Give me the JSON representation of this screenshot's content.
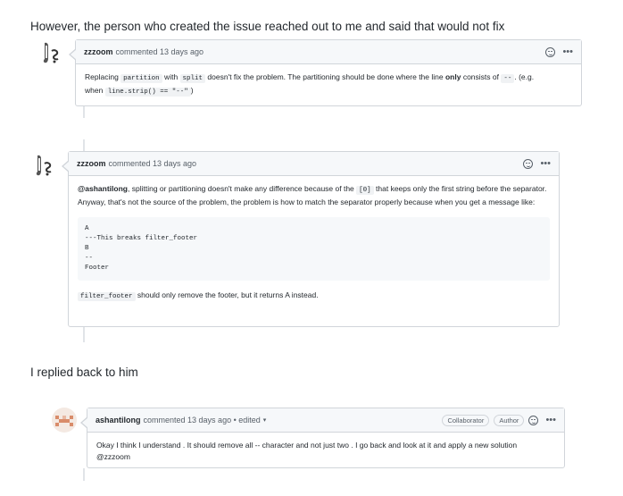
{
  "prose": {
    "line1": "However, the person who created the issue reached out to me and said that would not fix",
    "line2": "I replied back to him"
  },
  "comments": [
    {
      "author": "zzzoom",
      "meta": "commented 13 days ago",
      "body": {
        "t1": "Replacing ",
        "c1": "partition",
        "t2": " with ",
        "c2": "split",
        "t3": " doesn't fix the problem. The partitioning should be done where the line ",
        "strong": "only",
        "t4": " consists of ",
        "c3": "--",
        "t5": ". (e.g.",
        "t6": "when ",
        "c4": "line.strip() == \"--\"",
        "t7": ")"
      }
    },
    {
      "author": "zzzoom",
      "meta": "commented 13 days ago",
      "body": {
        "mention": "@ashantilong",
        "t1": ", splitting or partitioning doesn't make any difference because of the ",
        "c1": "[0]",
        "t2": " that keeps only the first string before the separator. Anyway, that's not the source of the problem, the problem is how to match the separator properly because when you get a message like:",
        "code_block": "A\n---This breaks filter_footer\nB\n--\nFooter",
        "c2": "filter_footer",
        "t3": " should only remove the footer, but it returns A instead."
      }
    },
    {
      "author": "ashantilong",
      "meta": "commented 13 days ago • edited",
      "badges": [
        "Collaborator",
        "Author"
      ],
      "body": {
        "text": "Okay I think I understand . It should remove all -- character and not just two . I go back and look at it and apply a new solution @zzzoom"
      }
    }
  ],
  "icons": [
    "octocat-avatar-icon",
    "pixel-avatar-icon",
    "emoji-reaction-icon",
    "kebab-menu-icon",
    "caret-down-icon"
  ]
}
